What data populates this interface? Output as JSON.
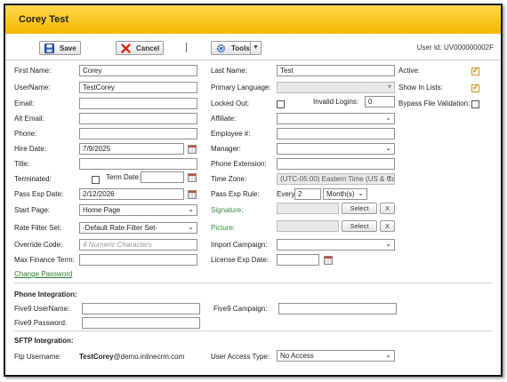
{
  "window": {
    "title": "Corey Test"
  },
  "toolbar": {
    "save_label": "Save",
    "cancel_label": "Cancel",
    "tools_label": "Tools",
    "user_id": "User Id: UV000000002F"
  },
  "form": {
    "first_name": {
      "label": "First Name:",
      "value": "Corey"
    },
    "last_name": {
      "label": "Last Name:",
      "value": "Test"
    },
    "active": {
      "label": "Active:",
      "checked": true
    },
    "username": {
      "label": "UserName:",
      "value": "TestCorey"
    },
    "primary_language": {
      "label": "Primary Language:",
      "value": ""
    },
    "show_in_lists": {
      "label": "Show In Lists:",
      "checked": true
    },
    "email": {
      "label": "Email:",
      "value": ""
    },
    "locked_out": {
      "label": "Locked Out:",
      "checked": false
    },
    "invalid_logins": {
      "label": "Invalid Logins:",
      "value": "0"
    },
    "bypass_file_validation": {
      "label": "Bypass File Validation:",
      "checked": false
    },
    "alt_email": {
      "label": "Alt Email:",
      "value": ""
    },
    "affiliate": {
      "label": "Affiliate:",
      "value": ""
    },
    "phone": {
      "label": "Phone:",
      "value": ""
    },
    "employee_no": {
      "label": "Employee #:",
      "value": ""
    },
    "hire_date": {
      "label": "Hire Date:",
      "value": "7/9/2025"
    },
    "manager": {
      "label": "Manager:",
      "value": ""
    },
    "title": {
      "label": "Title:",
      "value": ""
    },
    "phone_extension": {
      "label": "Phone Extension:",
      "value": ""
    },
    "terminated": {
      "label": "Terminated:",
      "checked": false
    },
    "term_date": {
      "label": "Term Date:",
      "value": ""
    },
    "time_zone": {
      "label": "Time Zone:",
      "value": "(UTC-05:00) Eastern Time (US & Canada)"
    },
    "pass_exp_date": {
      "label": "Pass Exp Date:",
      "value": "2/12/2026"
    },
    "pass_exp_rule": {
      "label": "Pass Exp Rule:",
      "every": "Every",
      "number": "2",
      "unit": "Month(s)"
    },
    "start_page": {
      "label": "Start Page:",
      "value": "Home Page"
    },
    "signature": {
      "label": "Signature:",
      "select": "Select",
      "clear": "X"
    },
    "rate_filter_set": {
      "label": "Rate Filter Set:",
      "value": "-Default Rate Filter Set-"
    },
    "picture": {
      "label": "Picture:",
      "select": "Select",
      "clear": "X"
    },
    "override_code": {
      "label": "Override Code:",
      "placeholder": "4 Numeric Characters"
    },
    "import_campaign": {
      "label": "Import Campaign:",
      "value": ""
    },
    "max_finance_term": {
      "label": "Max Finance Term:",
      "value": ""
    },
    "license_exp_date": {
      "label": "License Exp Date:",
      "value": ""
    },
    "change_password": "Change Password"
  },
  "phone_integration": {
    "heading": "Phone Integration:",
    "five9_username": {
      "label": "Five9 UserName:",
      "value": ""
    },
    "five9_campaign": {
      "label": "Five9 Campaign:",
      "value": ""
    },
    "five9_password": {
      "label": "Five9 Password:",
      "value": ""
    }
  },
  "sftp_integration": {
    "heading": "SFTP Integration:",
    "ftp_username": {
      "label": "Ftp Username:",
      "user": "TestCorey",
      "domain": "@demo.inlinecrm.com"
    },
    "user_access_type": {
      "label": "User Access Type:",
      "value": "No Access"
    }
  },
  "colors": {
    "title_bar": "#f6c200",
    "link": "#2b7a2b",
    "checkbox_check": "#c08b1a"
  },
  "icons": {
    "save": "floppy-disk-icon",
    "cancel": "red-x-icon",
    "tools": "gear-icon",
    "calendar": "calendar-icon"
  }
}
